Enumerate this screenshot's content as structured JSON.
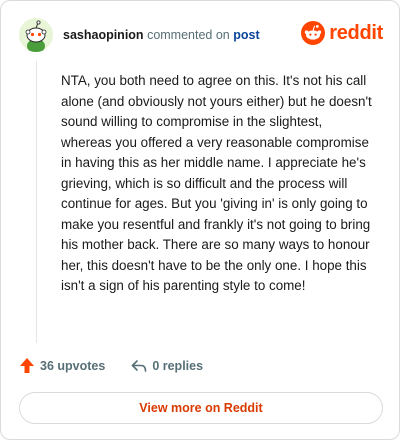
{
  "comment": {
    "username": "sashaopinion",
    "action_text": "commented on",
    "post_link": "post",
    "body": "NTA, you both need to agree on this. It's not his call alone (and obviously not yours either) but he doesn't sound willing to compromise in the slightest, whereas you offered a very reasonable compromise in having this as her middle name. I appreciate he's grieving, which is so difficult and the process will continue for ages. But you 'giving in' is only going to make you resentful and frankly it's not going to bring his mother back. There are so many ways to honour her, this doesn't have to be the only one. I hope this isn't a sign of his parenting style to come!"
  },
  "brand": {
    "wordmark": "reddit",
    "color": "#ff4500"
  },
  "actions": {
    "upvotes_label": "36 upvotes",
    "replies_label": "0 replies"
  },
  "footer": {
    "view_more_label": "View more on Reddit"
  },
  "icons": {
    "avatar": "snoo-avatar-icon",
    "logo": "reddit-logo-icon",
    "upvote": "upvote-arrow-icon",
    "reply": "reply-arrow-icon"
  },
  "colors": {
    "accent": "#ff4500",
    "link": "#0a449b",
    "muted": "#576f76",
    "button_text": "#d93a00"
  }
}
